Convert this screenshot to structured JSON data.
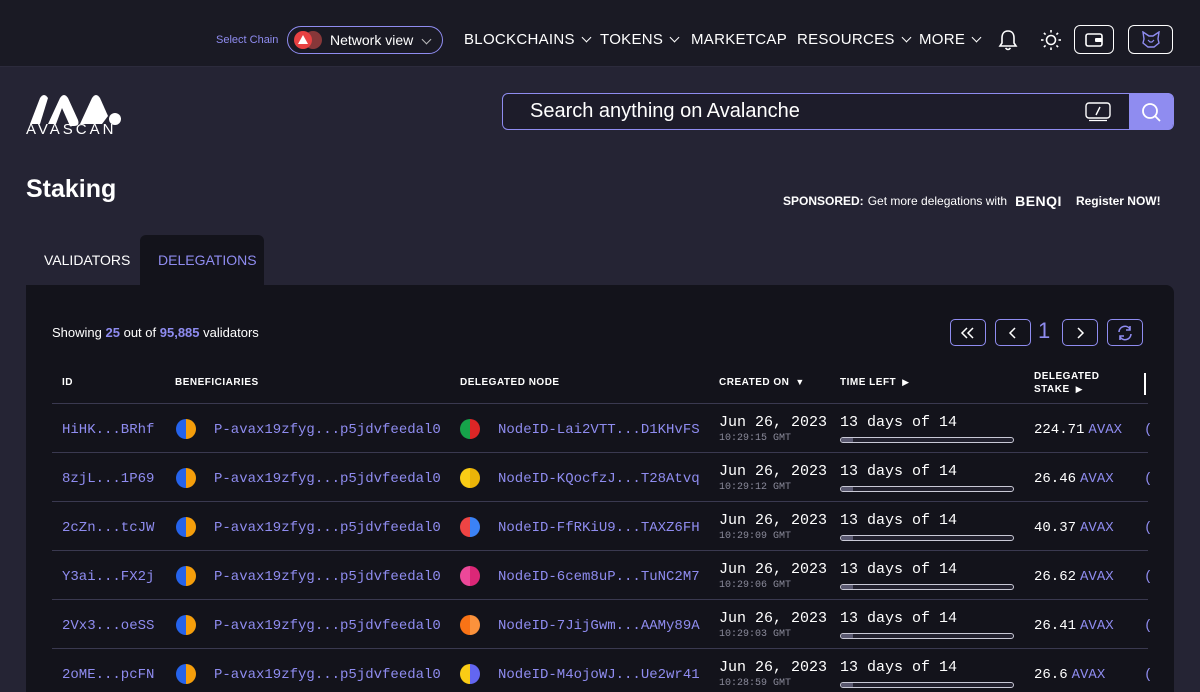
{
  "topnav": {
    "select_chain_label": "Select Chain",
    "chain_select_value": "Network view",
    "items": [
      "BLOCKCHAINS",
      "TOKENS",
      "MARKETCAP",
      "RESOURCES",
      "MORE"
    ]
  },
  "brand": {
    "name": "AVASCAN"
  },
  "search": {
    "placeholder": "Search anything on Avalanche"
  },
  "page": {
    "title": "Staking"
  },
  "sponsor": {
    "prefix": "SPONSORED:",
    "text": "Get more delegations with",
    "brand": "BENQI",
    "cta": "Register NOW!"
  },
  "tabs": [
    "VALIDATORS",
    "DELEGATIONS"
  ],
  "summary": {
    "prefix": "Showing",
    "count": "25",
    "middle": "out of",
    "total": "95,885",
    "suffix": "validators"
  },
  "pagination": {
    "current": "1"
  },
  "table": {
    "headers": {
      "id": "ID",
      "beneficiaries": "BENEFICIARIES",
      "node": "DELEGATED NODE",
      "created": "CREATED ON",
      "created_arrow": "▼",
      "time_left": "TIME LEFT",
      "time_left_arrow": "▶",
      "stake_line1": "DELEGATED",
      "stake_line2": "STAKE",
      "stake_arrow": "▶"
    },
    "rows": [
      {
        "id": "HiHK...BRhf",
        "beneficiary": "P-avax19zfyg...p5jdvfeedal0",
        "node": "NodeID-Lai2VTT...D1KHvFS",
        "date": "Jun 26, 2023",
        "time": "10:29:15 GMT",
        "time_left": "13 days of 14",
        "progress": 0.07,
        "stake": "224.71",
        "unit": "AVAX",
        "avatar_a": "#2563eb",
        "avatar_b": "#f59e0b",
        "node_a": "#16a34a",
        "node_b": "#dc2626"
      },
      {
        "id": "8zjL...1P69",
        "beneficiary": "P-avax19zfyg...p5jdvfeedal0",
        "node": "NodeID-KQocfzJ...T28Atvq",
        "date": "Jun 26, 2023",
        "time": "10:29:12 GMT",
        "time_left": "13 days of 14",
        "progress": 0.07,
        "stake": "26.46",
        "unit": "AVAX",
        "avatar_a": "#2563eb",
        "avatar_b": "#f59e0b",
        "node_a": "#facc15",
        "node_b": "#eab308"
      },
      {
        "id": "2cZn...tcJW",
        "beneficiary": "P-avax19zfyg...p5jdvfeedal0",
        "node": "NodeID-FfRKiU9...TAXZ6FH",
        "date": "Jun 26, 2023",
        "time": "10:29:09 GMT",
        "time_left": "13 days of 14",
        "progress": 0.07,
        "stake": "40.37",
        "unit": "AVAX",
        "avatar_a": "#2563eb",
        "avatar_b": "#f59e0b",
        "node_a": "#ef4444",
        "node_b": "#3b82f6"
      },
      {
        "id": "Y3ai...FX2j",
        "beneficiary": "P-avax19zfyg...p5jdvfeedal0",
        "node": "NodeID-6cem8uP...TuNC2M7",
        "date": "Jun 26, 2023",
        "time": "10:29:06 GMT",
        "time_left": "13 days of 14",
        "progress": 0.07,
        "stake": "26.62",
        "unit": "AVAX",
        "avatar_a": "#2563eb",
        "avatar_b": "#f59e0b",
        "node_a": "#ec4899",
        "node_b": "#db2777"
      },
      {
        "id": "2Vx3...oeSS",
        "beneficiary": "P-avax19zfyg...p5jdvfeedal0",
        "node": "NodeID-7JijGwm...AAMy89A",
        "date": "Jun 26, 2023",
        "time": "10:29:03 GMT",
        "time_left": "13 days of 14",
        "progress": 0.07,
        "stake": "26.41",
        "unit": "AVAX",
        "avatar_a": "#2563eb",
        "avatar_b": "#f59e0b",
        "node_a": "#f97316",
        "node_b": "#fb923c"
      },
      {
        "id": "2oME...pcFN",
        "beneficiary": "P-avax19zfyg...p5jdvfeedal0",
        "node": "NodeID-M4ojoWJ...Ue2wr41",
        "date": "Jun 26, 2023",
        "time": "10:28:59 GMT",
        "time_left": "13 days of 14",
        "progress": 0.07,
        "stake": "26.6",
        "unit": "AVAX",
        "avatar_a": "#2563eb",
        "avatar_b": "#f59e0b",
        "node_a": "#facc15",
        "node_b": "#6366f1"
      }
    ]
  },
  "colors": {
    "accent": "#8f8cf0",
    "background": "#252434",
    "panel": "#13131b"
  }
}
